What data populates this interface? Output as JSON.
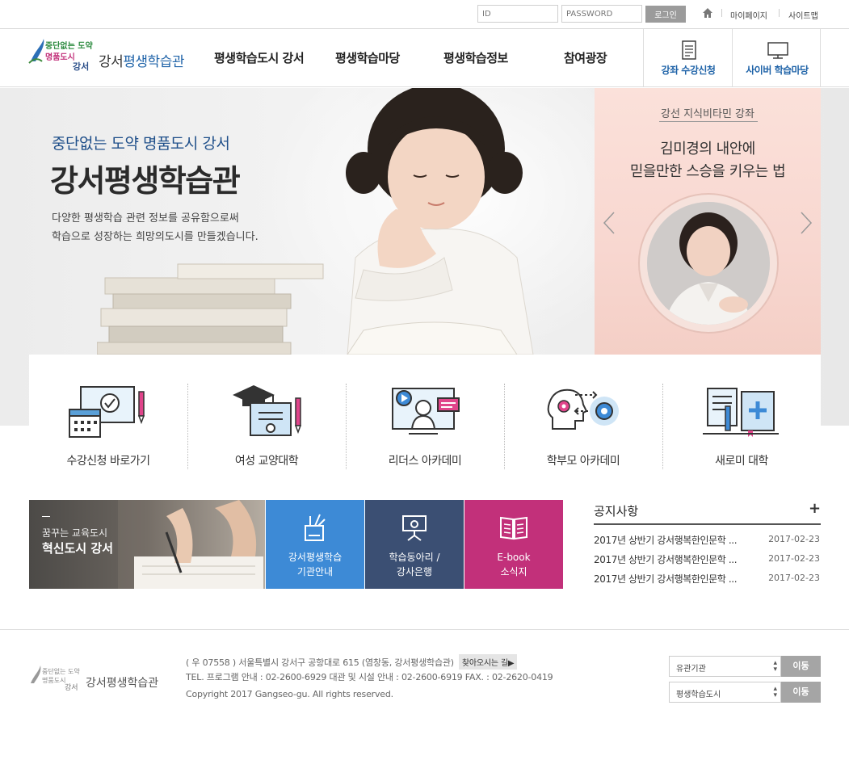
{
  "topbar": {
    "id_placeholder": "ID",
    "password_placeholder": "PASSWORD",
    "login_label": "로그인",
    "mypage_label": "마이페이지",
    "sitemap_label": "사이트맵"
  },
  "header": {
    "logo_text_plain": "강서",
    "logo_text_highlight": "평생학습관",
    "nav": [
      "평생학습도시 강서",
      "평생학습마당",
      "평생학습정보",
      "참여광장"
    ],
    "quick": [
      {
        "label": "강좌 수강신청",
        "icon": "document-icon"
      },
      {
        "label": "사이버 학습마당",
        "icon": "monitor-icon"
      }
    ]
  },
  "hero": {
    "subtitle": "중단없는 도약 명품도시 강서",
    "title": "강서평생학습관",
    "desc_line1": "다양한 평생학습 관련 정보를 공유함으로써",
    "desc_line2": "학습으로 성장하는 희망의도시를 만들겠습니다.",
    "slide": {
      "tag": "강선 지식비타민 강좌",
      "title_line1": "김미경의 내안에",
      "title_line2": "믿을만한 스승을 키우는 법"
    }
  },
  "programs": [
    {
      "label": "수강신청 바로가기",
      "icon": "calendar-monitor-icon"
    },
    {
      "label": "여성 교양대학",
      "icon": "graduation-cap-icon"
    },
    {
      "label": "리더스 아카데미",
      "icon": "video-lecture-icon"
    },
    {
      "label": "학부모 아카데미",
      "icon": "head-gear-icon"
    },
    {
      "label": "새로미 대학",
      "icon": "books-icon"
    }
  ],
  "promo": {
    "small": "꿈꾸는 교육도시",
    "big": "혁신도시 강서"
  },
  "tiles": [
    {
      "label": "강서평생학습\n기관안내",
      "color": "#3d8ad6",
      "icon": "pencil-cup-icon"
    },
    {
      "label": "학습동아리 /\n강사은행",
      "color": "#3b4f73",
      "icon": "lecture-board-icon"
    },
    {
      "label": "E-book\n소식지",
      "color": "#c2307a",
      "icon": "open-book-icon"
    }
  ],
  "notice": {
    "title": "공지사항",
    "items": [
      {
        "title": "2017년 상반기 강서행복한인문학 ...",
        "date": "2017-02-23"
      },
      {
        "title": "2017년 상반기 강서행복한인문학 ...",
        "date": "2017-02-23"
      },
      {
        "title": "2017년 상반기 강서행복한인문학 ...",
        "date": "2017-02-23"
      }
    ]
  },
  "footer": {
    "logo_text": "강서평생학습관",
    "address": "( 우 07558 ) 서울특별시 강서구 공항대로 615 (염창동, 강서평생학습관)",
    "find_label": "찾아오시는 길▶",
    "tel": "TEL. 프로그램 안내 : 02-2600-6929 대관 및 시설 안내 : 02-2600-6919 FAX. : 02-2620-0419",
    "copyright": "Copyright 2017 Gangseo-gu. All rights reserved.",
    "select1": "유관기관",
    "select2": "평생학습도시",
    "go_label": "이동"
  }
}
